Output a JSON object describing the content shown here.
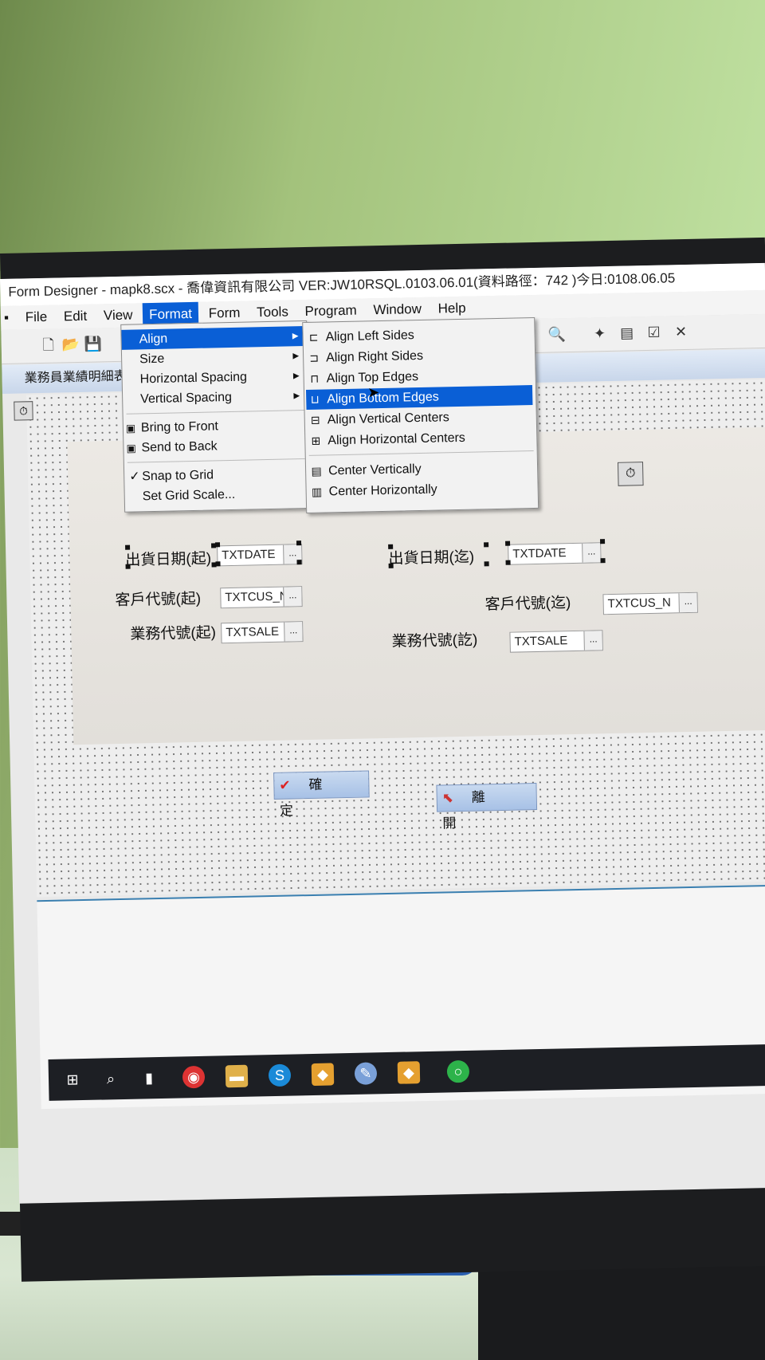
{
  "window": {
    "title": "Form Designer - mapk8.scx - 喬偉資訊有限公司  VER:JW10RSQL.0103.06.01(資料路徑：742 )今日:0108.06.05"
  },
  "menubar": {
    "items": [
      "File",
      "Edit",
      "View",
      "Format",
      "Form",
      "Tools",
      "Program",
      "Window",
      "Help"
    ],
    "active": "Format"
  },
  "format_menu": {
    "items": [
      {
        "label": "Align",
        "submenu": true,
        "highlighted": true
      },
      {
        "label": "Size",
        "submenu": true
      },
      {
        "label": "Horizontal Spacing",
        "submenu": true
      },
      {
        "label": "Vertical Spacing",
        "submenu": true
      },
      {
        "label": "Bring to Front"
      },
      {
        "label": "Send to Back"
      },
      {
        "label": "Snap to Grid",
        "checked": true
      },
      {
        "label": "Set Grid Scale..."
      }
    ]
  },
  "align_menu": {
    "items": [
      {
        "label": "Align Left Sides",
        "icon": "align-left-icon"
      },
      {
        "label": "Align Right Sides",
        "icon": "align-right-icon"
      },
      {
        "label": "Align Top Edges",
        "icon": "align-top-icon"
      },
      {
        "label": "Align Bottom Edges",
        "icon": "align-bottom-icon",
        "highlighted": true
      },
      {
        "label": "Align Vertical Centers",
        "icon": "align-vcenter-icon"
      },
      {
        "label": "Align Horizontal Centers",
        "icon": "align-hcenter-icon"
      },
      {
        "label": "Center Vertically",
        "icon": "center-vertical-icon"
      },
      {
        "label": "Center Horizontally",
        "icon": "center-horizontal-icon"
      }
    ]
  },
  "form_tab": {
    "label": "業務員業績明細表"
  },
  "form": {
    "fields": [
      {
        "label": "出貨日期(起)",
        "value": "TXTDATE"
      },
      {
        "label": "出貨日期(迄)",
        "value": "TXTDATE"
      },
      {
        "label": "客戶代號(起)",
        "value": "TXTCUS_N"
      },
      {
        "label": "客戶代號(迄)",
        "value": "TXTCUS_N"
      },
      {
        "label": "業務代號(起)",
        "value": "TXTSALE"
      },
      {
        "label": "業務代號(訖)",
        "value": "TXTSALE"
      }
    ],
    "lookup_button": "...",
    "ok_button": "確 定",
    "exit_button": "離 開"
  },
  "taskbar": {
    "icons": [
      "windows-start-icon",
      "search-icon",
      "task-view-icon",
      "chrome-icon",
      "file-explorer-icon",
      "skype-icon",
      "foxpro-icon",
      "paint-icon",
      "foxpro-icon",
      "line-icon"
    ]
  }
}
